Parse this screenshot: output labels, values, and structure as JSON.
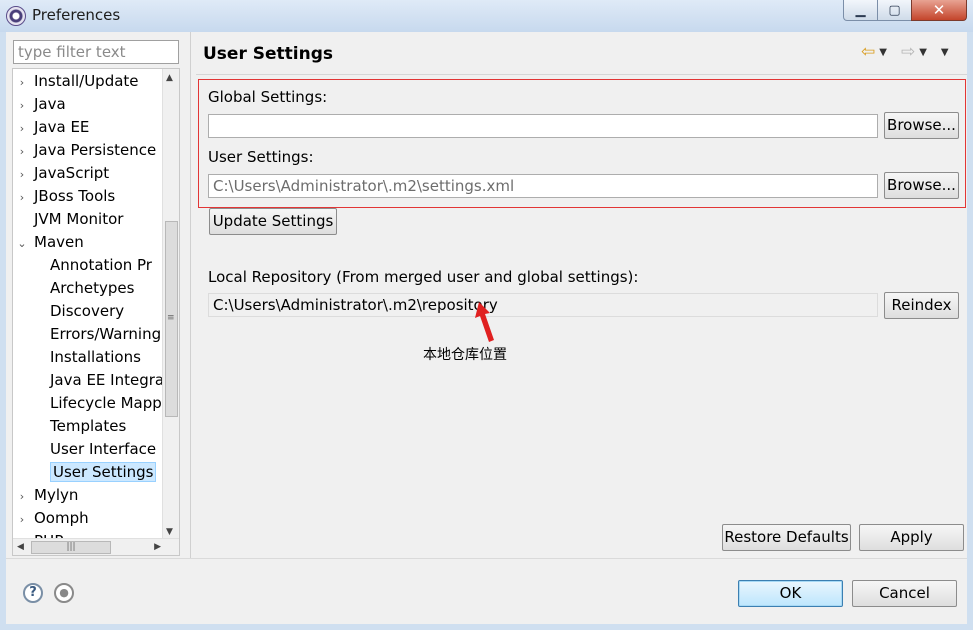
{
  "window": {
    "title": "Preferences",
    "minimize_glyph": "▁",
    "maximize_glyph": "▢",
    "close_glyph": "✕"
  },
  "sidebar": {
    "filter_placeholder": "type filter text",
    "items": [
      {
        "label": "Install/Update",
        "expander": "›",
        "level": 0
      },
      {
        "label": "Java",
        "expander": "›",
        "level": 0
      },
      {
        "label": "Java EE",
        "expander": "›",
        "level": 0
      },
      {
        "label": "Java Persistence",
        "expander": "›",
        "level": 0
      },
      {
        "label": "JavaScript",
        "expander": "›",
        "level": 0
      },
      {
        "label": "JBoss Tools",
        "expander": "›",
        "level": 0
      },
      {
        "label": "JVM Monitor",
        "expander": "",
        "level": 0
      },
      {
        "label": "Maven",
        "expander": "⌄",
        "level": 0
      },
      {
        "label": "Annotation Pr",
        "expander": "",
        "level": 1
      },
      {
        "label": "Archetypes",
        "expander": "",
        "level": 1
      },
      {
        "label": "Discovery",
        "expander": "",
        "level": 1
      },
      {
        "label": "Errors/Warning",
        "expander": "",
        "level": 1
      },
      {
        "label": "Installations",
        "expander": "",
        "level": 1
      },
      {
        "label": "Java EE Integra",
        "expander": "",
        "level": 1
      },
      {
        "label": "Lifecycle Mapp",
        "expander": "",
        "level": 1
      },
      {
        "label": "Templates",
        "expander": "",
        "level": 1
      },
      {
        "label": "User Interface",
        "expander": "",
        "level": 1
      },
      {
        "label": "User Settings",
        "expander": "",
        "level": 1
      },
      {
        "label": "Mylyn",
        "expander": "›",
        "level": 0
      },
      {
        "label": "Oomph",
        "expander": "›",
        "level": 0
      },
      {
        "label": "PHP",
        "expander": "›",
        "level": 0
      }
    ],
    "selected_index": 17
  },
  "page": {
    "title": "User Settings",
    "global_settings_label": "Global Settings:",
    "global_settings_value": "",
    "user_settings_label": "User Settings:",
    "user_settings_value": "C:\\Users\\Administrator\\.m2\\settings.xml",
    "browse_label": "Browse...",
    "update_settings_label": "Update Settings",
    "local_repo_label": "Local Repository (From merged user and global settings):",
    "local_repo_value": "C:\\Users\\Administrator\\.m2\\repository",
    "reindex_label": "Reindex",
    "annotation_text": "本地仓库位置",
    "restore_defaults_label": "Restore Defaults",
    "apply_label": "Apply"
  },
  "footer": {
    "help_glyph": "?",
    "ok_label": "OK",
    "cancel_label": "Cancel"
  },
  "colors": {
    "highlight_box": "#e23535",
    "annotation_arrow": "#e02020",
    "selection": "#cce8ff"
  }
}
